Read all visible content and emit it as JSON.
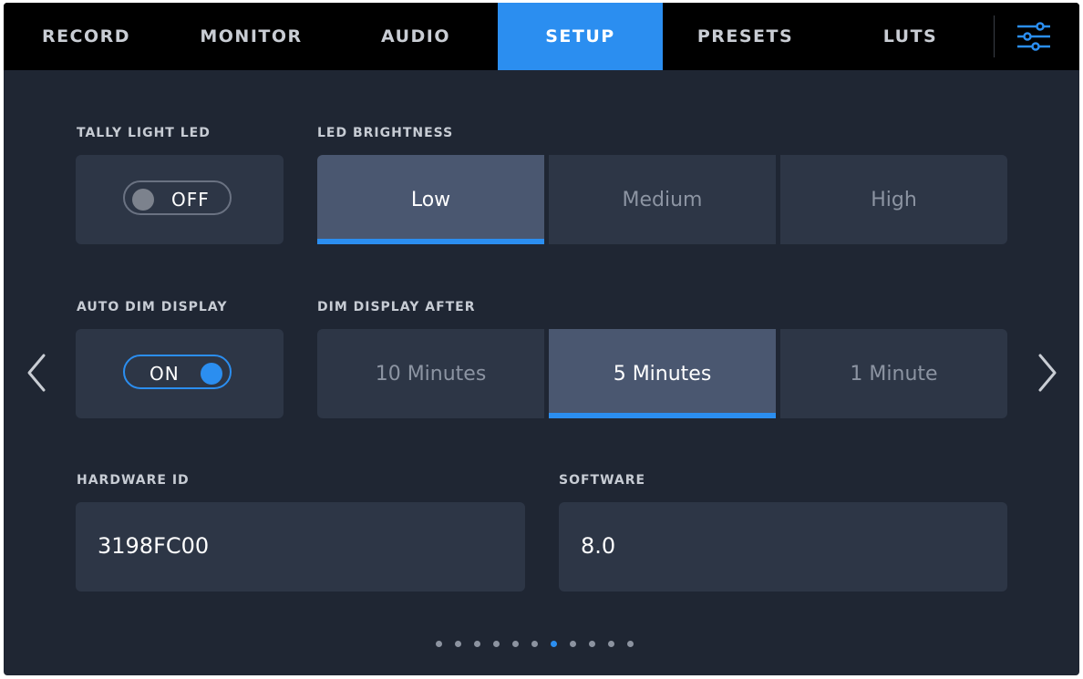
{
  "tabs": [
    {
      "label": "RECORD",
      "active": false
    },
    {
      "label": "MONITOR",
      "active": false
    },
    {
      "label": "AUDIO",
      "active": false
    },
    {
      "label": "SETUP",
      "active": true
    },
    {
      "label": "PRESETS",
      "active": false
    },
    {
      "label": "LUTS",
      "active": false
    }
  ],
  "menu_icon": "sliders-icon",
  "tally_light_led": {
    "label": "TALLY LIGHT LED",
    "toggle_text": "OFF",
    "state": "off"
  },
  "led_brightness": {
    "label": "LED BRIGHTNESS",
    "options": [
      "Low",
      "Medium",
      "High"
    ],
    "selected": "Low"
  },
  "auto_dim_display": {
    "label": "AUTO DIM DISPLAY",
    "toggle_text": "ON",
    "state": "on"
  },
  "dim_display_after": {
    "label": "DIM DISPLAY AFTER",
    "options": [
      "10 Minutes",
      "5 Minutes",
      "1 Minute"
    ],
    "selected": "5 Minutes"
  },
  "hardware_id": {
    "label": "HARDWARE ID",
    "value": "3198FC00"
  },
  "software": {
    "label": "SOFTWARE",
    "value": "8.0"
  },
  "navigation": {
    "prev_icon": "chevron-left-icon",
    "next_icon": "chevron-right-icon"
  },
  "pagination": {
    "total": 11,
    "current": 7
  },
  "colors": {
    "accent": "#2b8ef0",
    "background": "#1f2633",
    "tile": "#2d3646",
    "selected_tile": "#4a5770"
  }
}
